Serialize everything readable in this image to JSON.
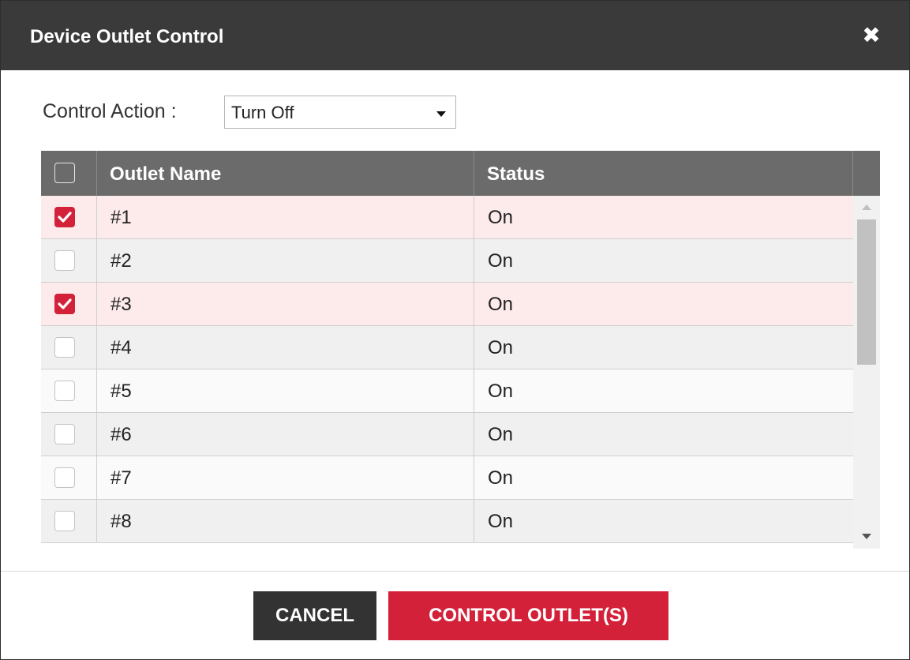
{
  "dialog": {
    "title": "Device Outlet Control",
    "close_icon": "close-icon"
  },
  "control_action": {
    "label": "Control Action :",
    "selected": "Turn Off"
  },
  "table": {
    "headers": [
      "Outlet Name",
      "Status"
    ],
    "rows": [
      {
        "name": "#1",
        "status": "On",
        "checked": true
      },
      {
        "name": "#2",
        "status": "On",
        "checked": false
      },
      {
        "name": "#3",
        "status": "On",
        "checked": true
      },
      {
        "name": "#4",
        "status": "On",
        "checked": false
      },
      {
        "name": "#5",
        "status": "On",
        "checked": false
      },
      {
        "name": "#6",
        "status": "On",
        "checked": false
      },
      {
        "name": "#7",
        "status": "On",
        "checked": false
      },
      {
        "name": "#8",
        "status": "On",
        "checked": false
      }
    ]
  },
  "buttons": {
    "cancel": "CANCEL",
    "control": "CONTROL OUTLET(S)"
  },
  "colors": {
    "accent": "#d4213a",
    "header_bg": "#3a3a3a",
    "table_header_bg": "#6b6b6b",
    "row_selected_bg": "#fdeaea",
    "row_odd_bg": "#fafafa",
    "row_even_bg": "#f0f0f0"
  }
}
